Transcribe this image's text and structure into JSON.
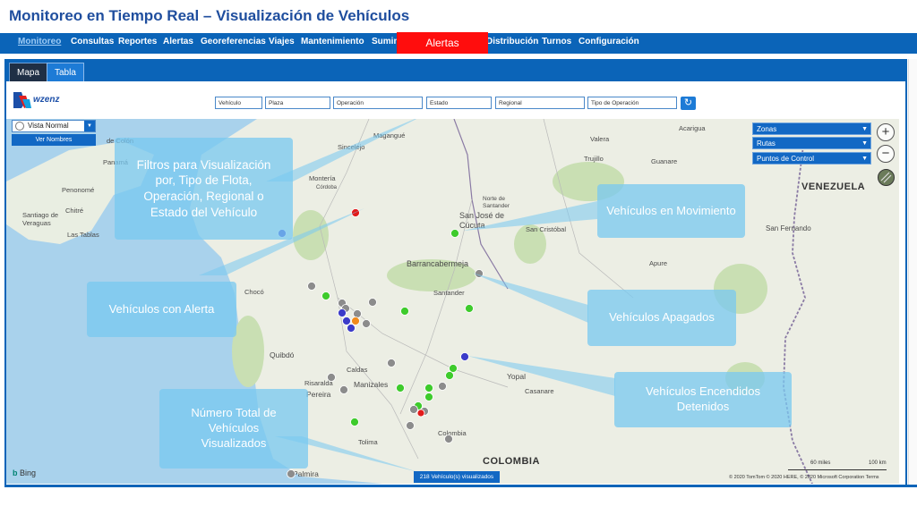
{
  "page_title": "Monitoreo en Tiempo Real – Visualización de Vehículos",
  "nav": {
    "items": [
      "Monitoreo",
      "Consultas",
      "Reportes",
      "Alertas",
      "Georeferencias",
      "Viajes",
      "Mantenimiento",
      "Sumin",
      "Distribución",
      "Turnos",
      "Configuración"
    ],
    "alert_button": "Alertas"
  },
  "tabs": [
    "Mapa",
    "Tabla"
  ],
  "brand": "wzenz",
  "filters": {
    "vehiculo": "Vehículo",
    "plaza": "Plaza",
    "operacion": "Operación",
    "estado": "Estado",
    "regional": "Regional",
    "tipo_operacion": "Tipo de Operación"
  },
  "view_select": {
    "value": "Vista Normal",
    "button": "Ver Nombres"
  },
  "layer_dropdowns": [
    "Zonas",
    "Rutas",
    "Puntos de Control"
  ],
  "callouts": {
    "filtros": "Filtros para Visualización por, Tipo de Flota, Operación, Regional o Estado del Vehículo",
    "movimiento": "Vehículos en Movimiento",
    "alerta": "Vehículos con Alerta",
    "apagados": "Vehículos Apagados",
    "encendidos": "Vehículos Encendidos Detenidos",
    "total": "Número Total de Vehículos Visualizados"
  },
  "map_labels": {
    "colombia": "COLOMBIA",
    "venezuela": "VENEZUELA",
    "magangue": "Magangué",
    "sincelejo": "Sincelejo",
    "monteria": "Montería",
    "cordoba": "Córdoba",
    "colon": "de Colón",
    "panama": "Panamá",
    "penonome": "Penonomé",
    "chitre": "Chitré",
    "santiago": "Santiago de Veraguas",
    "tablas": "Las Tablas",
    "valera": "Valera",
    "acarigua": "Acarigua",
    "guanare": "Guanare",
    "trujillo": "Trujillo",
    "cucuta": "San José de Cúcuta",
    "cristobal": "San Cristóbal",
    "norte_santander": "Norte de Santander",
    "barranca": "Barrancabermeja",
    "santander": "Santander",
    "choco": "Chocó",
    "quibdo": "Quibdó",
    "manizales": "Manizales",
    "pereira": "Pereira",
    "caldas": "Caldas",
    "risaralda": "Risaralda",
    "tolima": "Tolima",
    "yopal": "Yopal",
    "casanare": "Casanare",
    "apure": "Apure",
    "fernando": "San Fernando",
    "palmira": "Palmira",
    "colombia_leyenda": "Colombia"
  },
  "total_badge": "218 Vehículo(s) visualizados",
  "attribution": {
    "bing": "Bing",
    "copyright": "© 2020 TomTom © 2020 HERE, © 2020 Microsoft Corporation  Terms",
    "scale_mi": "60 miles",
    "scale_km": "100 km"
  },
  "colors": {
    "nav": "#0b64b8",
    "alert": "#ff0d0d",
    "moving": "#3ecb2c",
    "stopped_on": "#3b3bc9",
    "off": "#8c8c8c",
    "alarm": "#e21b1b",
    "callout": "#78c8f0"
  }
}
